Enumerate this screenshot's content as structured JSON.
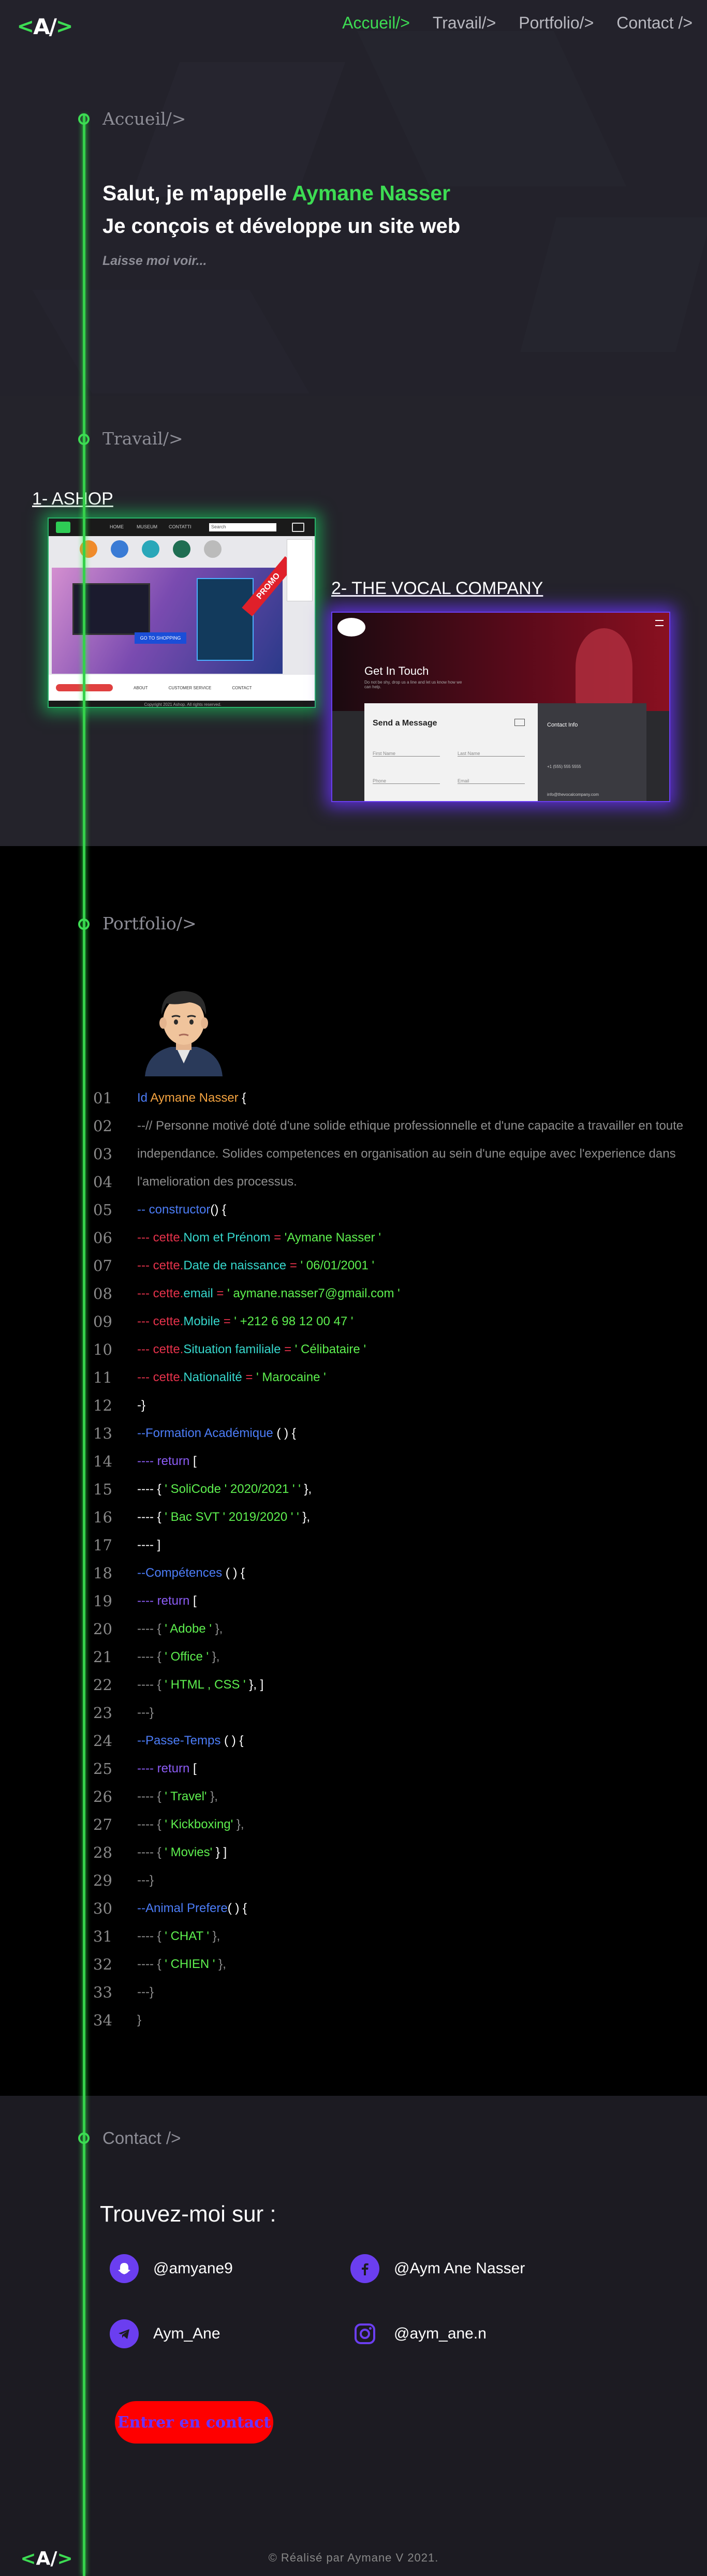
{
  "header": {
    "logo_left": "<",
    "logo_mid": "A/",
    "logo_right": ">",
    "nav": [
      "Accueil/>",
      "Travail/>",
      "Portfolio/>",
      "Contact />"
    ]
  },
  "hero": {
    "section_title": "Accueil/>",
    "greeting": "Salut, je m'appelle ",
    "name": "Aymane Nasser",
    "subtitle": "Je conçois et développe un site web",
    "hint": "Laisse moi voir..."
  },
  "travail": {
    "section_title": "Travail/>",
    "projects": [
      {
        "label": "1- ASHOP"
      },
      {
        "label": "2- THE VOCAL COMPANY"
      }
    ],
    "ashop": {
      "nav": [
        "HOME",
        "MUSEUM",
        "CONTATTI"
      ],
      "search": "Search",
      "banner": "GO TO SHOPPING",
      "ribbon": "PROMO",
      "footer_links": [
        "ABOUT",
        "CUSTOMER SERVICE",
        "CONTACT"
      ],
      "footer_text": "Copyright 2021 Ashop. All rights reserved."
    },
    "vocal": {
      "hero_title": "Get In Touch",
      "hero_text": "Do not be shy, drop us a line and let us know how we can help.",
      "form_title": "Send a Message",
      "fields": [
        "First Name",
        "Last Name",
        "Phone",
        "Email"
      ],
      "info_title": "Contact Info",
      "phone": "+1 (555) 555 5555",
      "email": "info@thevocalcompany.com"
    }
  },
  "portfolio": {
    "section_title": "Portfolio/>",
    "code": [
      {
        "n": "01",
        "parts": [
          [
            "c-blue",
            "Id "
          ],
          [
            "c-orange",
            "Aymane Nasser "
          ],
          [
            "c-white",
            "{"
          ]
        ]
      },
      {
        "n": "02",
        "parts": [
          [
            "c-gray",
            "--// Personne motivé doté d'une solide ethique professionnelle et d'une capacite a travailler en toute"
          ]
        ]
      },
      {
        "n": "03",
        "parts": [
          [
            "c-gray",
            "independance. Solides competences en organisation au sein d'une equipe avec l'experience dans"
          ]
        ]
      },
      {
        "n": "04",
        "parts": [
          [
            "c-gray",
            "l'amelioration des processus."
          ]
        ]
      },
      {
        "n": "05",
        "parts": [
          [
            "c-blue",
            "-- constructor"
          ],
          [
            "c-white",
            "() {"
          ]
        ]
      },
      {
        "n": "06",
        "parts": [
          [
            "c-red",
            "--- cette."
          ],
          [
            "c-cyan",
            "Nom et Prénom "
          ],
          [
            "c-red",
            " = "
          ],
          [
            "c-green",
            "'Aymane Nasser '"
          ]
        ]
      },
      {
        "n": "07",
        "parts": [
          [
            "c-red",
            "--- cette."
          ],
          [
            "c-cyan",
            "Date de naissance "
          ],
          [
            "c-red",
            " = "
          ],
          [
            "c-green",
            "' 06/01/2001 '"
          ]
        ]
      },
      {
        "n": "08",
        "parts": [
          [
            "c-red",
            "--- cette."
          ],
          [
            "c-cyan",
            "email "
          ],
          [
            "c-red",
            " = "
          ],
          [
            "c-green",
            "' aymane.nasser7@gmail.com '"
          ]
        ]
      },
      {
        "n": "09",
        "parts": [
          [
            "c-red",
            "--- cette."
          ],
          [
            "c-cyan",
            "Mobile "
          ],
          [
            "c-red",
            " = "
          ],
          [
            "c-green",
            "' +212 6 98 12 00 47 '"
          ]
        ]
      },
      {
        "n": "10",
        "parts": [
          [
            "c-red",
            "--- cette."
          ],
          [
            "c-cyan",
            "Situation familiale "
          ],
          [
            "c-red",
            " = "
          ],
          [
            "c-green",
            "' Célibataire '"
          ]
        ]
      },
      {
        "n": "11",
        "parts": [
          [
            "c-red",
            "--- cette."
          ],
          [
            "c-cyan",
            "Nationalité "
          ],
          [
            "c-red",
            " = "
          ],
          [
            "c-green",
            "' Marocaine '"
          ]
        ]
      },
      {
        "n": "12",
        "parts": [
          [
            "c-white",
            "-}"
          ]
        ]
      },
      {
        "n": "13",
        "parts": [
          [
            "c-blue",
            "--Formation Académique "
          ],
          [
            "c-white",
            "( ) {"
          ]
        ]
      },
      {
        "n": "14",
        "parts": [
          [
            "c-purple",
            "---- return "
          ],
          [
            "c-white",
            "["
          ]
        ]
      },
      {
        "n": "15",
        "parts": [
          [
            "c-white",
            "---- { "
          ],
          [
            "c-green",
            "' SoliCode ' 2020/2021 ' '"
          ],
          [
            "c-white",
            " },"
          ]
        ]
      },
      {
        "n": "16",
        "parts": [
          [
            "c-white",
            "---- { "
          ],
          [
            "c-green",
            "' Bac SVT ' 2019/2020 ' '"
          ],
          [
            "c-white",
            " },"
          ]
        ]
      },
      {
        "n": "17",
        "parts": [
          [
            "c-white",
            "---- ]"
          ]
        ]
      },
      {
        "n": "18",
        "parts": [
          [
            "c-blue",
            "--Compétences "
          ],
          [
            "c-white",
            "( ) {"
          ]
        ]
      },
      {
        "n": "19",
        "parts": [
          [
            "c-purple",
            "---- return "
          ],
          [
            "c-white",
            "["
          ]
        ]
      },
      {
        "n": "20",
        "parts": [
          [
            "c-gray",
            "---- { "
          ],
          [
            "c-green",
            "' Adobe ' "
          ],
          [
            "c-gray",
            "},"
          ]
        ]
      },
      {
        "n": "21",
        "parts": [
          [
            "c-gray",
            "---- { "
          ],
          [
            "c-green",
            "' Office ' "
          ],
          [
            "c-gray",
            "},"
          ]
        ]
      },
      {
        "n": "22",
        "parts": [
          [
            "c-gray",
            "---- { "
          ],
          [
            "c-green",
            "' HTML , CSS ' "
          ],
          [
            "c-white",
            "}, ]"
          ]
        ]
      },
      {
        "n": "23",
        "parts": [
          [
            "c-gray",
            "---}"
          ]
        ]
      },
      {
        "n": "24",
        "parts": [
          [
            "c-blue",
            "--Passe-Temps "
          ],
          [
            "c-white",
            "( ) {"
          ]
        ]
      },
      {
        "n": "25",
        "parts": [
          [
            "c-purple",
            "---- return "
          ],
          [
            "c-white",
            "["
          ]
        ]
      },
      {
        "n": "26",
        "parts": [
          [
            "c-gray",
            "---- { "
          ],
          [
            "c-green",
            "' Travel' "
          ],
          [
            "c-gray",
            "},"
          ]
        ]
      },
      {
        "n": "27",
        "parts": [
          [
            "c-gray",
            "---- { "
          ],
          [
            "c-green",
            "' Kickboxing' "
          ],
          [
            "c-gray",
            "},"
          ]
        ]
      },
      {
        "n": "28",
        "parts": [
          [
            "c-gray",
            "---- { "
          ],
          [
            "c-green",
            "' Movies' "
          ],
          [
            "c-white",
            "} ]"
          ]
        ]
      },
      {
        "n": "29",
        "parts": [
          [
            "c-gray",
            "---}"
          ]
        ]
      },
      {
        "n": "30",
        "parts": [
          [
            "c-blue",
            "--Animal Prefere"
          ],
          [
            "c-white",
            "( ) {"
          ]
        ]
      },
      {
        "n": "31",
        "parts": [
          [
            "c-gray",
            "---- { "
          ],
          [
            "c-green",
            "' CHAT ' "
          ],
          [
            "c-gray",
            "},"
          ]
        ]
      },
      {
        "n": "32",
        "parts": [
          [
            "c-gray",
            "---- { "
          ],
          [
            "c-green",
            "' CHIEN ' "
          ],
          [
            "c-gray",
            "},"
          ]
        ]
      },
      {
        "n": "33",
        "parts": [
          [
            "c-gray",
            "---}"
          ]
        ]
      },
      {
        "n": "34",
        "parts": [
          [
            "c-gray",
            "}"
          ]
        ]
      }
    ]
  },
  "contact": {
    "section_title": "Contact />",
    "heading": "Trouvez-moi sur :",
    "socials": [
      {
        "icon": "snapchat-icon",
        "handle": "@amyane9"
      },
      {
        "icon": "facebook-icon",
        "handle": "@Aym Ane Nasser"
      },
      {
        "icon": "telegram-icon",
        "handle": "Aym_Ane"
      },
      {
        "icon": "instagram-icon",
        "handle": "@aym_ane.n"
      }
    ],
    "button": "Entrer en contact"
  },
  "footer": {
    "copyright": "© Réalisé par Aymane V 2021."
  },
  "colors": {
    "accent": "#3ddc53",
    "glow_green": "#1e8a4a",
    "glow_purple": "#5a2fd0",
    "button": "#ff0000",
    "icon_bg": "#6b3ef0"
  }
}
